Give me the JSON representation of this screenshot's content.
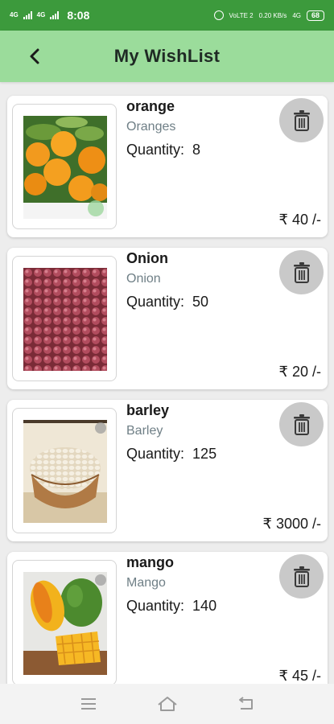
{
  "status_bar": {
    "time": "8:08",
    "network_left": [
      "4G",
      "4G"
    ],
    "volte_text": "VoLTE 2",
    "speed_text": "0.20 KB/s",
    "network_right": "4G",
    "battery": "68"
  },
  "header": {
    "title": "My WishList",
    "back_icon": "back-arrow-icon"
  },
  "wishlist": [
    {
      "name": "orange",
      "category": "Oranges",
      "quantity_label": "Quantity:",
      "quantity": "8",
      "price": "₹ 40 /-",
      "image_icon": "orange-image"
    },
    {
      "name": "Onion",
      "category": "Onion",
      "quantity_label": "Quantity:",
      "quantity": "50",
      "price": "₹ 20 /-",
      "image_icon": "onion-image"
    },
    {
      "name": "barley",
      "category": "Barley",
      "quantity_label": "Quantity:",
      "quantity": "125",
      "price": "₹ 3000 /-",
      "image_icon": "barley-image"
    },
    {
      "name": "mango",
      "category": "Mango",
      "quantity_label": "Quantity:",
      "quantity": "140",
      "price": "₹ 45 /-",
      "image_icon": "mango-image"
    }
  ],
  "nav_bar": {
    "icons": [
      "menu-icon",
      "home-icon",
      "back-icon"
    ]
  },
  "colors": {
    "status_bar": "#3c9a3c",
    "header": "#9bdc9b",
    "delete_button": "#c9c9c9",
    "category_text": "#6f7f86"
  }
}
